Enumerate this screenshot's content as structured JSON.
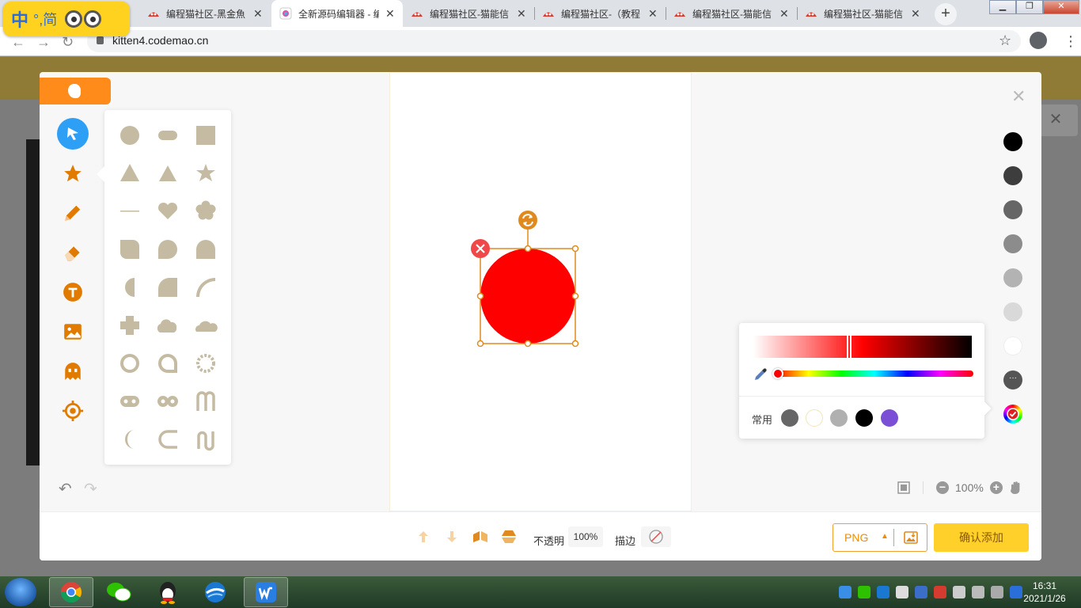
{
  "ime": {
    "label_zh": "中",
    "label_mid": "°,简"
  },
  "browser": {
    "tabs": [
      {
        "title": "编程猫社区-黑金魚"
      },
      {
        "title": "全新源码编辑器 - 编程"
      },
      {
        "title": "编程猫社区-猫能信"
      },
      {
        "title": "编程猫社区-（教程"
      },
      {
        "title": "编程猫社区-猫能信"
      },
      {
        "title": "编程猫社区-猫能信"
      }
    ],
    "active_tab": 1,
    "new_tab": "+",
    "url": "kitten4.codemao.cn"
  },
  "editor": {
    "tools": [
      "select",
      "shape",
      "brush",
      "eraser",
      "text",
      "image",
      "character",
      "target"
    ],
    "active_tool": "select",
    "shapes": [
      "circle",
      "rounded-rect",
      "square",
      "triangle",
      "triangle-small",
      "star",
      "line",
      "heart",
      "flower",
      "leaf",
      "bubble",
      "arch",
      "half-circle",
      "quarter-circle",
      "arc",
      "cross",
      "cloud",
      "cloud-flat",
      "ring",
      "speech-ring",
      "gear-ring",
      "pill-dots",
      "double-ring",
      "m-shape",
      "crescent",
      "c-shape",
      "n-shape"
    ],
    "selected_shape": {
      "type": "circle",
      "fill": "#ff0000"
    },
    "swatches": [
      "#000000",
      "#3d3d3d",
      "#666666",
      "#8c8c8c",
      "#b3b3b3",
      "#d9d9d9",
      "#ffffff"
    ],
    "more_label": "···",
    "color_picker": {
      "shade_color": "#ff0000",
      "recent_label": "常用",
      "recent": [
        "#666666",
        "#ffffff",
        "#b0b0b0",
        "#000000",
        "#7a4fd6"
      ]
    },
    "zoom": "100%",
    "bottom": {
      "opacity_label": "不透明",
      "opacity_value": "100%",
      "stroke_label": "描边",
      "format": "PNG",
      "confirm": "确认添加"
    }
  },
  "taskbar": {
    "time": "16:31",
    "date": "2021/1/26"
  },
  "colors": {
    "accent_orange": "#ff8c1a",
    "tool_orange": "#e07b00",
    "select_blue": "#2d9ff5",
    "shape_gray": "#c5bba3",
    "confirm_yellow": "#ffd02a"
  }
}
